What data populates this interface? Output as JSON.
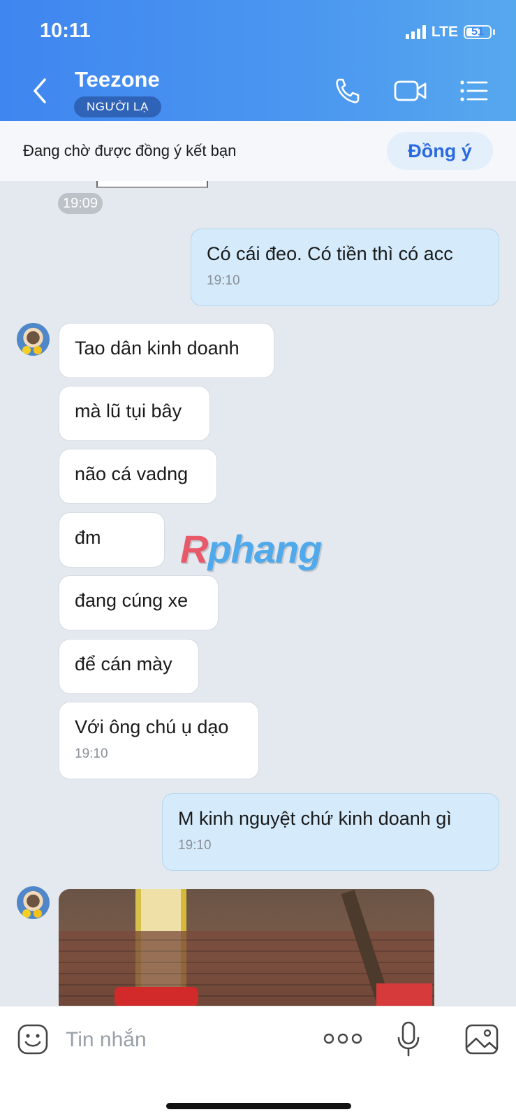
{
  "status_bar": {
    "time": "10:11",
    "network": "LTE",
    "battery": "51"
  },
  "header": {
    "contact_name": "Teezone",
    "badge": "NGƯỜI LẠ",
    "icons": [
      "back-icon",
      "phone-icon",
      "video-call-icon",
      "menu-list-icon"
    ]
  },
  "friend_request": {
    "text": "Đang chờ được đồng ý kết bạn",
    "accept_label": "Đồng ý"
  },
  "chat": {
    "first_time": "19:09",
    "msg1": {
      "text": "Có cái đeo. Có tiền thì có acc",
      "time": "19:10"
    },
    "group": {
      "lines": [
        "Tao dân kinh doanh",
        "mà lũ tụi bây",
        "não cá vadng",
        "đm",
        "đang cúng xe",
        "để cán mày"
      ],
      "last": "Với ông chú ụ dạo",
      "time": "19:10"
    },
    "msg2": {
      "text": "M kinh nguyệt chứ kinh doanh gì",
      "time": "19:10"
    }
  },
  "watermark": {
    "first": "R",
    "rest": "phang"
  },
  "input": {
    "placeholder": "Tin nhắn"
  },
  "colors": {
    "header_blue": "#3f86f0",
    "outgoing_bubble": "#d5ebfb",
    "accent": "#2a6ae0"
  }
}
